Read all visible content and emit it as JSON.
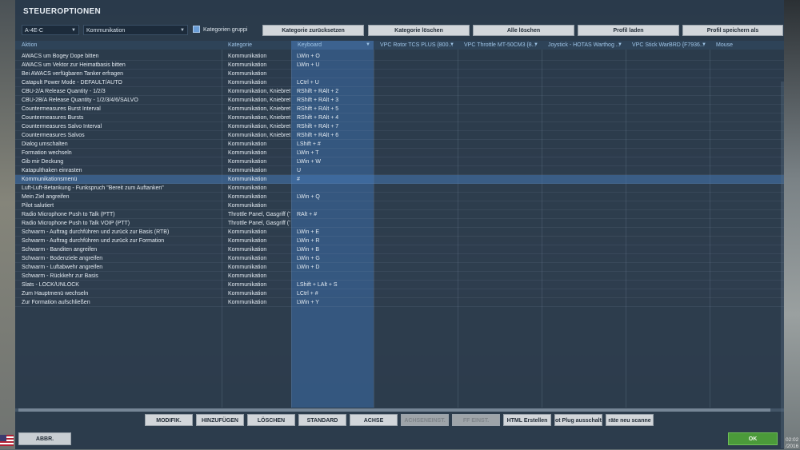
{
  "window": {
    "title": "STEUEROPTIONEN"
  },
  "toolbar": {
    "aircraft": "A-4E-C",
    "category": "Kommunikation",
    "group_label": "Kategorien gruppi",
    "reset_category": "Kategorie zurücksetzen",
    "delete_category": "Kategorie löschen",
    "delete_all": "Alle löschen",
    "load_profile": "Profil laden",
    "save_profile": "Profil speichern als"
  },
  "columns": {
    "action": "Aktion",
    "category": "Kategorie",
    "keyboard": "Keyboard",
    "dev1": "VPC Rotor TCS PLUS {800...",
    "dev2": "VPC Throttle MT-50CM3 {8...",
    "dev3": "Joystick - HOTAS Warthog ...",
    "dev4": "VPC Stick WarBRD {F7936...",
    "mouse": "Mouse"
  },
  "rows": [
    {
      "action": "AWACS um Bogey Dope bitten",
      "category": "Kommunikation",
      "keyboard": "LWin + O"
    },
    {
      "action": "AWACS um Vektor zur Heimatbasis bitten",
      "category": "Kommunikation",
      "keyboard": "LWin + U"
    },
    {
      "action": "Bei AWACS verfügbaren Tanker erfragen",
      "category": "Kommunikation",
      "keyboard": ""
    },
    {
      "action": "Catapult Power Mode - DEFAULT/AUTO",
      "category": "Kommunikation",
      "keyboard": "LCtrl + U"
    },
    {
      "action": "CBU-2/A Release Quantity - 1/2/3",
      "category": "Kommunikation, Kniebrett",
      "keyboard": "RShift + RAlt + 2"
    },
    {
      "action": "CBU-2B/A Release Quantity - 1/2/3/4/6/SALVO",
      "category": "Kommunikation, Kniebrett",
      "keyboard": "RShift + RAlt + 3"
    },
    {
      "action": "Countermeasures Burst Interval",
      "category": "Kommunikation, Kniebrett",
      "keyboard": "RShift + RAlt + 5"
    },
    {
      "action": "Countermeasures Bursts",
      "category": "Kommunikation, Kniebrett",
      "keyboard": "RShift + RAlt + 4"
    },
    {
      "action": "Countermeasures Salvo Interval",
      "category": "Kommunikation, Kniebrett",
      "keyboard": "RShift + RAlt + 7"
    },
    {
      "action": "Countermeasures Salvos",
      "category": "Kommunikation, Kniebrett",
      "keyboard": "RShift + RAlt + 6"
    },
    {
      "action": "Dialog umschalten",
      "category": "Kommunikation",
      "keyboard": "LShift + #"
    },
    {
      "action": "Formation wechseln",
      "category": "Kommunikation",
      "keyboard": "LWin + T"
    },
    {
      "action": "Gib mir Deckung",
      "category": "Kommunikation",
      "keyboard": "LWin + W"
    },
    {
      "action": "Katapulthaken einrasten",
      "category": "Kommunikation",
      "keyboard": "U"
    },
    {
      "action": "Kommunikationsmenü",
      "category": "Kommunikation",
      "keyboard": "#"
    },
    {
      "action": "Luft-Luft-Betankung - Funkspruch \"Bereit zum Auftanken\"",
      "category": "Kommunikation",
      "keyboard": ""
    },
    {
      "action": "Mein Ziel angreifen",
      "category": "Kommunikation",
      "keyboard": "LWin + Q"
    },
    {
      "action": "Pilot salutiert",
      "category": "Kommunikation",
      "keyboard": ""
    },
    {
      "action": "Radio Microphone Push to Talk (PTT)",
      "category": "Throttle Panel, Gasgriff (T",
      "keyboard": "RAlt + #"
    },
    {
      "action": "Radio Microphone Push to Talk VOIP (PTT)",
      "category": "Throttle Panel, Gasgriff (T",
      "keyboard": ""
    },
    {
      "action": "Schwarm - Auftrag durchführen und zurück zur Basis (RTB)",
      "category": "Kommunikation",
      "keyboard": "LWin + E"
    },
    {
      "action": "Schwarm - Auftrag durchführen und zurück zur Formation",
      "category": "Kommunikation",
      "keyboard": "LWin + R"
    },
    {
      "action": "Schwarm - Banditen angreifen",
      "category": "Kommunikation",
      "keyboard": "LWin + B"
    },
    {
      "action": "Schwarm - Bodenziele angreifen",
      "category": "Kommunikation",
      "keyboard": "LWin + G"
    },
    {
      "action": "Schwarm - Luftabwehr angreifen",
      "category": "Kommunikation",
      "keyboard": "LWin + D"
    },
    {
      "action": "Schwarm - Rückkehr zur Basis",
      "category": "Kommunikation",
      "keyboard": ""
    },
    {
      "action": "Slats - LOCK/UNLOCK",
      "category": "Kommunikation",
      "keyboard": "LShift + LAlt + S"
    },
    {
      "action": "Zum Hauptmenü wechseln",
      "category": "Kommunikation",
      "keyboard": "LCtrl + #"
    },
    {
      "action": "Zur Formation aufschließen",
      "category": "Kommunikation",
      "keyboard": "LWin + Y"
    }
  ],
  "selected_row": 14,
  "footer": {
    "modify": "MODIFIK.",
    "add": "HINZUFÜGEN",
    "delete": "LÖSCHEN",
    "standard": "STANDARD",
    "axis": "ACHSE",
    "axis_settings": "ACHSENEINST.",
    "ff_settings": "FF EINST.",
    "html_create": "HTML Erstellen",
    "plug_off": "ot Plug ausschalte",
    "rescan": "räte neu scanne",
    "cancel": "ABBR.",
    "ok": "OK"
  },
  "taskbar": {
    "time": "02:02",
    "year": "/2016"
  },
  "colors": {
    "panel": "#263648",
    "accent": "#4b9a3a",
    "keyboard_col": "#3c6eaa"
  }
}
